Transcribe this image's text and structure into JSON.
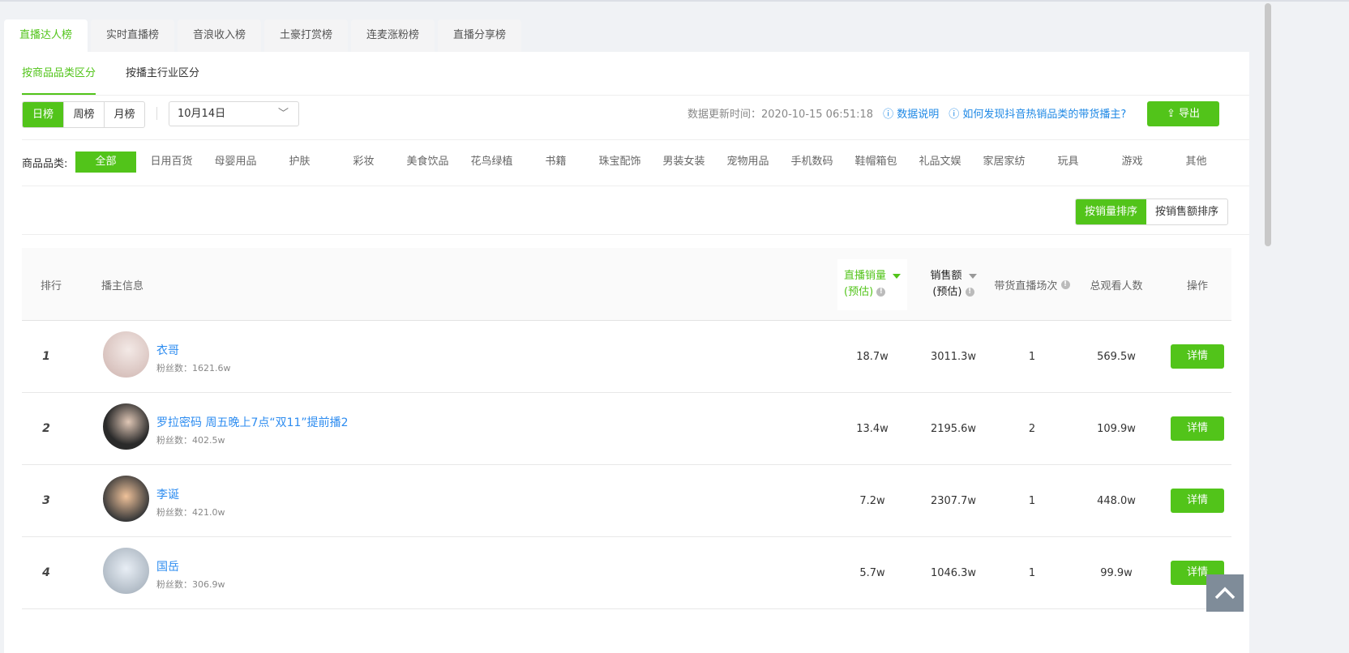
{
  "tabs": [
    "直播达人榜",
    "实时直播榜",
    "音浪收入榜",
    "土豪打赏榜",
    "连麦涨粉榜",
    "直播分享榜"
  ],
  "subtabs": [
    "按商品品类区分",
    "按播主行业区分"
  ],
  "period": [
    "日榜",
    "周榜",
    "月榜"
  ],
  "date": "10月14日",
  "update_time": "数据更新时间：2020-10-15 06:51:18",
  "data_desc": "数据说明",
  "howto": "如何发现抖音热销品类的带货播主?",
  "export": "导出",
  "cat_label": "商品品类:",
  "categories": [
    "全部",
    "日用百货",
    "母婴用品",
    "护肤",
    "彩妆",
    "美食饮品",
    "花鸟绿植",
    "书籍",
    "珠宝配饰",
    "男装女装",
    "宠物用品",
    "手机数码",
    "鞋帽箱包",
    "礼品文娱",
    "家居家纺",
    "玩具",
    "游戏",
    "其他"
  ],
  "sort": [
    "按销量排序",
    "按销售额排序"
  ],
  "headers": {
    "rank": "排行",
    "info": "播主信息",
    "sales": "直播销量",
    "sales2": "(预估)",
    "amount": "销售额",
    "amount2": "(预估)",
    "sessions": "带货直播场次",
    "viewers": "总观看人数",
    "action": "操作"
  },
  "rows": [
    {
      "rank": "1",
      "name": "衣哥",
      "fans": "粉丝数：1621.6w",
      "sales": "18.7w",
      "amount": "3011.3w",
      "sessions": "1",
      "viewers": "569.5w",
      "action": "详情"
    },
    {
      "rank": "2",
      "name": "罗拉密码 周五晚上7点“双11”提前播2",
      "fans": "粉丝数：402.5w",
      "sales": "13.4w",
      "amount": "2195.6w",
      "sessions": "2",
      "viewers": "109.9w",
      "action": "详情"
    },
    {
      "rank": "3",
      "name": "李诞",
      "fans": "粉丝数：421.0w",
      "sales": "7.2w",
      "amount": "2307.7w",
      "sessions": "1",
      "viewers": "448.0w",
      "action": "详情"
    },
    {
      "rank": "4",
      "name": "国岳",
      "fans": "粉丝数：306.9w",
      "sales": "5.7w",
      "amount": "1046.3w",
      "sessions": "1",
      "viewers": "99.9w",
      "action": "详情"
    }
  ]
}
